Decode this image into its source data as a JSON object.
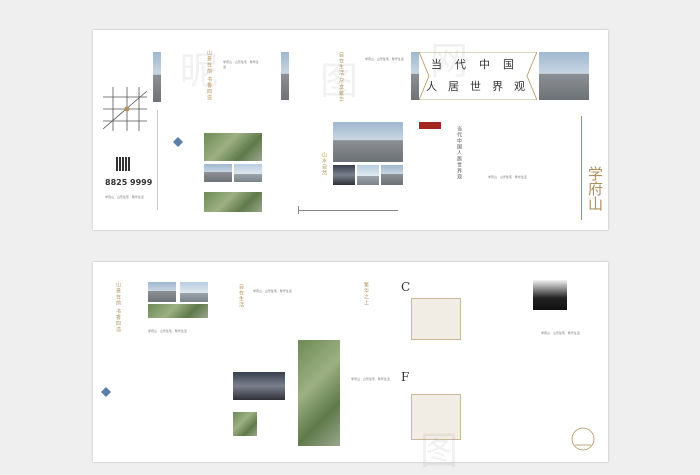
{
  "top_sheet": {
    "header_row1": [
      "当",
      "代",
      "中",
      "国"
    ],
    "header_row2": [
      "人",
      "居",
      "世",
      "界",
      "观"
    ],
    "phone": "8825 9999",
    "brand": "学府山",
    "vertical_title_left": "山景在前 书香四溢",
    "vertical_title_center": "自在生活 尽享繁华",
    "vertical_title_right": "当代中国人居世界观",
    "slogan_center": "山水自然",
    "bodytext": "学府山 · 山景住宅 · 繁华生活"
  },
  "bottom_sheet": {
    "vertical_title_left": "山景在前 书香四溢",
    "vertical_title_mid": "自在生活",
    "vertical_title_right": "繁华之上",
    "plan_c_letter": "C",
    "plan_f_letter": "F"
  },
  "watermark": [
    "昵",
    "图",
    "网",
    "图"
  ],
  "colors": {
    "gold": "#b0915b",
    "sheet": "#ffffff",
    "background": "#efefef"
  }
}
